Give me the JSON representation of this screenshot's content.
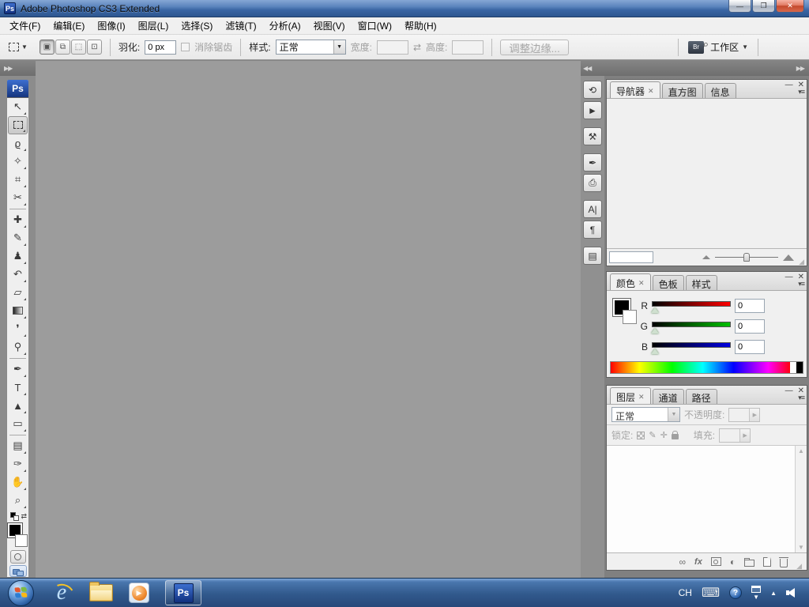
{
  "window": {
    "title": "Adobe Photoshop CS3 Extended",
    "app_icon": "Ps",
    "controls": {
      "minimize": "—",
      "restore": "❐",
      "close": "✕"
    }
  },
  "menu_bar": {
    "items": [
      {
        "name": "file",
        "label": "文件(F)"
      },
      {
        "name": "edit",
        "label": "编辑(E)"
      },
      {
        "name": "image",
        "label": "图像(I)"
      },
      {
        "name": "layer",
        "label": "图层(L)"
      },
      {
        "name": "select",
        "label": "选择(S)"
      },
      {
        "name": "filter",
        "label": "滤镜(T)"
      },
      {
        "name": "analysis",
        "label": "分析(A)"
      },
      {
        "name": "view",
        "label": "视图(V)"
      },
      {
        "name": "window",
        "label": "窗口(W)"
      },
      {
        "name": "help",
        "label": "帮助(H)"
      }
    ]
  },
  "options_bar": {
    "mode_buttons": [
      {
        "name": "new-selection",
        "glyph": "▣",
        "selected": true
      },
      {
        "name": "add-to-selection",
        "glyph": "⧉"
      },
      {
        "name": "subtract-from-selection",
        "glyph": "⬚"
      },
      {
        "name": "intersect-selection",
        "glyph": "⊡"
      }
    ],
    "feather": {
      "label": "羽化:",
      "value": "0 px"
    },
    "antialias": {
      "label": "消除锯齿"
    },
    "style": {
      "label": "样式:",
      "value": "正常"
    },
    "width": {
      "label": "宽度:",
      "value": ""
    },
    "swap_glyph": "⇄",
    "height": {
      "label": "高度:",
      "value": ""
    },
    "refine_edge_label": "调整边缘...",
    "bridge_label": "Br",
    "workspace_label": "工作区"
  },
  "toolbox": {
    "logo": "Ps",
    "tools": [
      {
        "name": "move",
        "glyph": "↖"
      },
      {
        "name": "rectangular-marquee",
        "glyph": "",
        "kind": "marquee",
        "selected": true
      },
      {
        "name": "lasso",
        "glyph": "ϱ"
      },
      {
        "name": "quick-selection",
        "glyph": "✧"
      },
      {
        "name": "crop",
        "glyph": "⌗"
      },
      {
        "name": "slice",
        "glyph": "✂",
        "divider_after": true
      },
      {
        "name": "spot-healing-brush",
        "glyph": "✚"
      },
      {
        "name": "brush",
        "glyph": "✎"
      },
      {
        "name": "clone-stamp",
        "glyph": "♟"
      },
      {
        "name": "history-brush",
        "glyph": "↶"
      },
      {
        "name": "eraser",
        "glyph": "▱"
      },
      {
        "name": "gradient",
        "glyph": "",
        "kind": "gradient"
      },
      {
        "name": "blur",
        "glyph": "❜"
      },
      {
        "name": "dodge",
        "glyph": "⚲",
        "divider_after": true
      },
      {
        "name": "pen",
        "glyph": "✒"
      },
      {
        "name": "type",
        "glyph": "T"
      },
      {
        "name": "path-selection",
        "glyph": "▲"
      },
      {
        "name": "shape",
        "glyph": "▭",
        "divider_after": true
      },
      {
        "name": "notes",
        "glyph": "▤"
      },
      {
        "name": "eyedropper",
        "glyph": "✑"
      },
      {
        "name": "hand",
        "glyph": "✋"
      },
      {
        "name": "zoom",
        "glyph": "⌕"
      }
    ]
  },
  "right_dock_icons": [
    {
      "name": "history",
      "glyph": "⟲"
    },
    {
      "name": "actions",
      "glyph": "►",
      "gap_after": true
    },
    {
      "name": "tool-presets",
      "glyph": "⚒",
      "gap_after": true
    },
    {
      "name": "brushes",
      "glyph": "✒"
    },
    {
      "name": "clone-source",
      "glyph": "⎙",
      "gap_after": true
    },
    {
      "name": "character",
      "glyph": "A|"
    },
    {
      "name": "paragraph",
      "glyph": "¶",
      "gap_after": true
    },
    {
      "name": "layer-comps",
      "glyph": "▤"
    }
  ],
  "panels": {
    "navigator": {
      "tabs": [
        "导航器",
        "直方图",
        "信息"
      ],
      "zoom_value": ""
    },
    "color": {
      "tabs": [
        "颜色",
        "色板",
        "样式"
      ],
      "channels": [
        {
          "label": "R",
          "value": "0",
          "color": "#ff0000"
        },
        {
          "label": "G",
          "value": "0",
          "color": "#00c000"
        },
        {
          "label": "B",
          "value": "0",
          "color": "#0000e0"
        }
      ]
    },
    "layers": {
      "tabs": [
        "图层",
        "通道",
        "路径"
      ],
      "blend_mode": "正常",
      "opacity_label": "不透明度:",
      "opacity_value": "",
      "lock_label": "锁定:",
      "fill_label": "填充:",
      "fill_value": ""
    }
  },
  "taskbar": {
    "tray": {
      "language": "CH"
    }
  },
  "colors": {
    "titlebar_blue": "#3a66a4",
    "taskbar_blue": "#31598c",
    "ps_brand_blue": "#16357e",
    "canvas_gray": "#9c9c9c",
    "dock_gray": "#808080"
  }
}
